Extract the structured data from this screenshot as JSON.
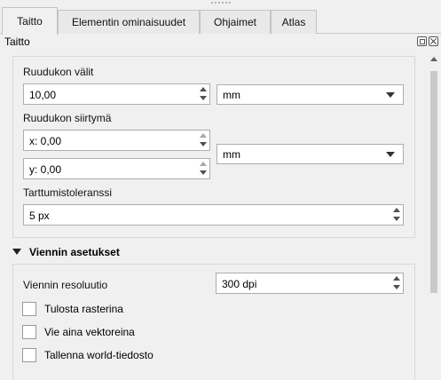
{
  "tabs": [
    {
      "label": "Taitto",
      "active": true
    },
    {
      "label": "Elementin ominaisuudet",
      "active": false
    },
    {
      "label": "Ohjaimet",
      "active": false
    },
    {
      "label": "Atlas",
      "active": false
    }
  ],
  "panel": {
    "title": "Taitto"
  },
  "grid": {
    "spacing_label": "Ruudukon välit",
    "spacing_value": "10,00",
    "spacing_unit": "mm",
    "offset_label": "Ruudukon siirtymä",
    "offset_x": "x: 0,00",
    "offset_y": "y: 0,00",
    "offset_unit": "mm",
    "snap_label": "Tarttumistoleranssi",
    "snap_value": "5 px"
  },
  "export": {
    "section_label": "Viennin asetukset",
    "resolution_label": "Viennin resoluutio",
    "resolution_value": "300 dpi",
    "print_raster_label": "Tulosta rasterina",
    "print_raster_checked": false,
    "always_vector_label": "Vie aina vektoreina",
    "always_vector_checked": false,
    "world_file_label": "Tallenna world-tiedosto",
    "world_file_checked": false
  }
}
